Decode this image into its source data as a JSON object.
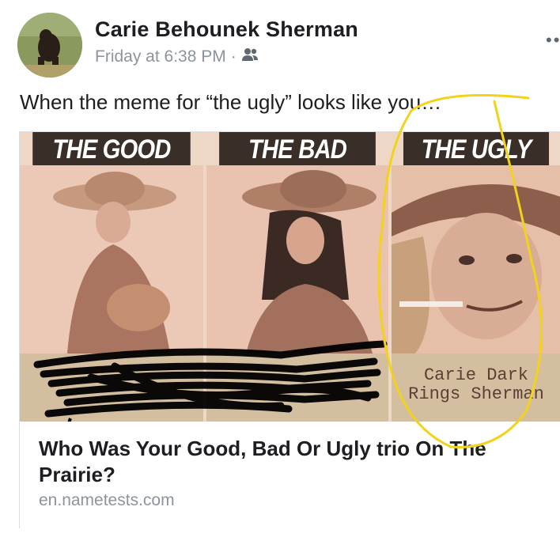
{
  "post": {
    "author": "Carie Behounek Sherman",
    "timestamp": "Friday at 6:38 PM",
    "separator": "·",
    "audience_icon": "friends-icon",
    "text": "When the meme for “the ugly” looks like you…"
  },
  "card": {
    "panels": [
      {
        "heading": "THE GOOD",
        "caption_lines": [
          "",
          ""
        ]
      },
      {
        "heading": "THE BAD",
        "caption_lines": [
          "",
          ""
        ]
      },
      {
        "heading": "THE UGLY",
        "caption_lines": [
          "Carie Dark",
          "Rings Sherman"
        ]
      }
    ],
    "link_title": "Who Was Your Good, Bad Or Ugly trio On The Prairie?",
    "link_domain": "en.nametests.com"
  },
  "colors": {
    "panel_header": "#3a2e28",
    "caption_bg": "#d4bea0",
    "photo_tint": "#e8c6b4",
    "circle_annotation": "#f2d21b",
    "scribble": "#000000",
    "timestamp_text": "#8d949e"
  }
}
